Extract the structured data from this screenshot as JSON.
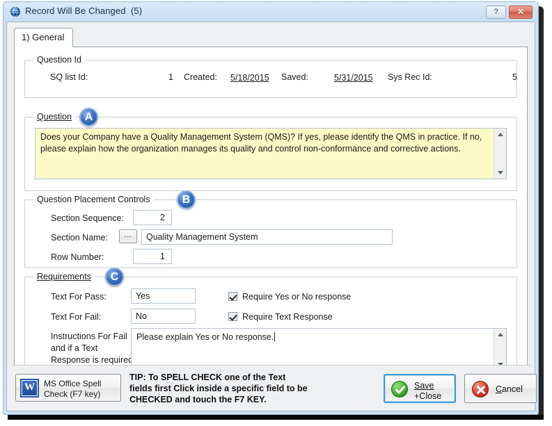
{
  "window": {
    "title": "Record Will Be Changed  (5)",
    "icon": "globe-icon",
    "help_label": "?",
    "close_label": "✕"
  },
  "tabs": [
    {
      "label": "1) General"
    }
  ],
  "groups": {
    "question_id": {
      "title": "Question Id",
      "fields": {
        "sq_list_id_label": "SQ list Id:",
        "sq_list_id_value": "1",
        "created_label": "Created:",
        "created_value": "5/18/2015",
        "saved_label": "Saved:",
        "saved_value": "5/31/2015",
        "sys_rec_id_label": "Sys Rec Id:",
        "sys_rec_id_value": "5"
      }
    },
    "question": {
      "title": "Question",
      "badge": "A",
      "text": "Does your Company have a Quality Management System (QMS)? If yes, please identify the QMS in practice. If no, please explain how the organization manages its quality and control non-conformance and corrective actions."
    },
    "placement": {
      "title": "Question Placement Controls",
      "badge": "B",
      "section_sequence_label": "Section Sequence:",
      "section_sequence_value": "2",
      "section_name_label": "Section Name:",
      "section_name_browse": "...",
      "section_name_value": "Quality Management System",
      "row_number_label": "Row Number:",
      "row_number_value": "1"
    },
    "requirements": {
      "title": "Requirements",
      "badge": "C",
      "text_for_pass_label": "Text For Pass:",
      "text_for_pass_value": "Yes",
      "text_for_fail_label": "Text For Fail:",
      "text_for_fail_value": "No",
      "require_yes_no_label": "Require Yes or No response",
      "require_yes_no_checked": true,
      "require_text_label": "Require Text Response",
      "require_text_checked": true,
      "instructions_label_line1": "Instructions For Fail",
      "instructions_label_line2": "and if a Text",
      "instructions_label_line3": "Response is required:",
      "instructions_value": "Please explain Yes or No response."
    }
  },
  "footer": {
    "spell_check_line1": "MS Office Spell",
    "spell_check_line2": "Check (F7 key)",
    "spell_check_icon": "word-icon",
    "word_glyph": "W",
    "tip_line1": "TIP: To SPELL CHECK one of the Text",
    "tip_line2": "fields first Click inside a specific field to be",
    "tip_line3": "CHECKED and touch the F7 KEY.",
    "save_line1": "Save",
    "save_line2": "+Close",
    "cancel_label": "Cancel"
  },
  "colors": {
    "frame": "#cfe2f3",
    "accent_blue": "#3a6fc4",
    "question_bg": "#fbfbc8",
    "focus_border": "#3c9ad6",
    "close_red": "#cf5a48",
    "ok_green": "#42b02d"
  }
}
